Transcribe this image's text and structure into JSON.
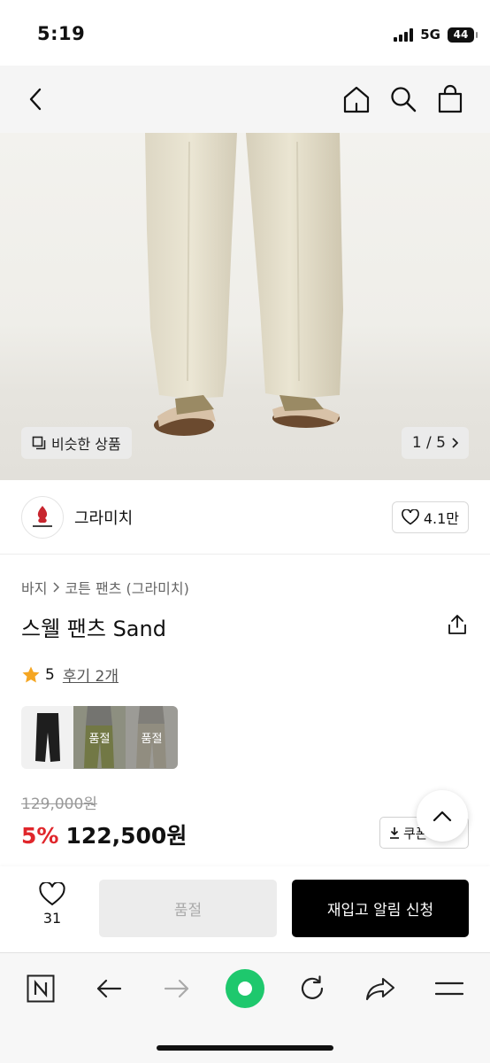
{
  "status_bar": {
    "time": "5:19",
    "network": "5G",
    "battery": "44"
  },
  "header": {
    "back_icon": "chevron-left-icon",
    "home_icon": "home-icon",
    "search_icon": "search-icon",
    "bag_icon": "shopping-bag-icon"
  },
  "gallery": {
    "similar_label": "비슷한 상품",
    "page_indicator": "1 / 5"
  },
  "brand": {
    "name": "그라미치",
    "likes": "4.1만"
  },
  "breadcrumb": {
    "category": "바지",
    "subcategory": "코튼 팬츠 (그라미치)"
  },
  "product": {
    "title": "스웰 팬츠 Sand",
    "rating": "5",
    "reviews_label": "후기 2개",
    "original_price": "129,000원",
    "discount": "5%",
    "sale_price": "122,500원",
    "coupon_label": "쿠폰"
  },
  "swatches": [
    {
      "color": "black",
      "label": ""
    },
    {
      "color": "olive",
      "label": "품절"
    },
    {
      "color": "sand",
      "label": "품절"
    }
  ],
  "purchase_bar": {
    "wish_count": "31",
    "soldout_label": "품절",
    "restock_label": "재입고 알림 신청"
  },
  "colors": {
    "sale_red": "#e0262b",
    "primary_black": "#000000",
    "disabled_gray": "#ececec",
    "browser_green": "#1ec86d"
  }
}
